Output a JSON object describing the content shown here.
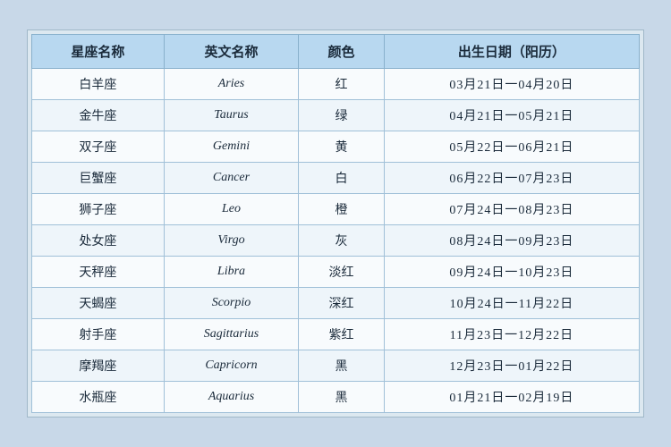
{
  "table": {
    "headers": [
      "星座名称",
      "英文名称",
      "颜色",
      "出生日期（阳历）"
    ],
    "rows": [
      {
        "chinese": "白羊座",
        "english": "Aries",
        "color": "红",
        "date": "03月21日一04月20日"
      },
      {
        "chinese": "金牛座",
        "english": "Taurus",
        "color": "绿",
        "date": "04月21日一05月21日"
      },
      {
        "chinese": "双子座",
        "english": "Gemini",
        "color": "黄",
        "date": "05月22日一06月21日"
      },
      {
        "chinese": "巨蟹座",
        "english": "Cancer",
        "color": "白",
        "date": "06月22日一07月23日"
      },
      {
        "chinese": "狮子座",
        "english": "Leo",
        "color": "橙",
        "date": "07月24日一08月23日"
      },
      {
        "chinese": "处女座",
        "english": "Virgo",
        "color": "灰",
        "date": "08月24日一09月23日"
      },
      {
        "chinese": "天秤座",
        "english": "Libra",
        "color": "淡红",
        "date": "09月24日一10月23日"
      },
      {
        "chinese": "天蝎座",
        "english": "Scorpio",
        "color": "深红",
        "date": "10月24日一11月22日"
      },
      {
        "chinese": "射手座",
        "english": "Sagittarius",
        "color": "紫红",
        "date": "11月23日一12月22日"
      },
      {
        "chinese": "摩羯座",
        "english": "Capricorn",
        "color": "黑",
        "date": "12月23日一01月22日"
      },
      {
        "chinese": "水瓶座",
        "english": "Aquarius",
        "color": "黑",
        "date": "01月21日一02月19日"
      }
    ]
  }
}
